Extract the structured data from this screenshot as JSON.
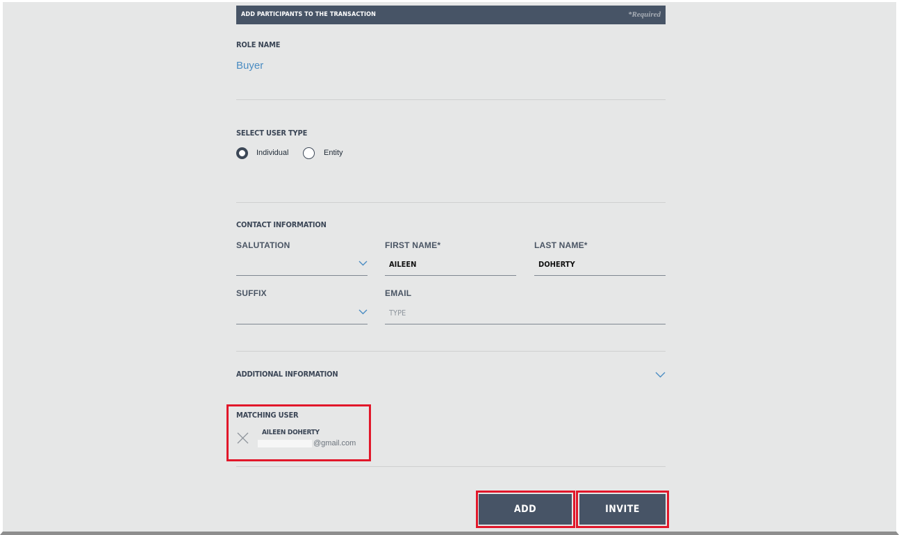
{
  "header": {
    "title": "ADD PARTICIPANTS TO THE TRANSACTION",
    "required_note": "*Required"
  },
  "role": {
    "label": "ROLE NAME",
    "value": "Buyer"
  },
  "user_type": {
    "label": "SELECT USER TYPE",
    "options": [
      {
        "label": "Individual",
        "selected": true
      },
      {
        "label": "Entity",
        "selected": false
      }
    ]
  },
  "contact": {
    "label": "CONTACT INFORMATION",
    "salutation": {
      "label": "SALUTATION",
      "value": ""
    },
    "first_name": {
      "label": "FIRST NAME*",
      "value": "AILEEN"
    },
    "last_name": {
      "label": "LAST NAME*",
      "value": "DOHERTY"
    },
    "suffix": {
      "label": "SUFFIX",
      "value": ""
    },
    "email": {
      "label": "EMAIL",
      "placeholder": "TYPE",
      "value": ""
    }
  },
  "additional": {
    "label": "ADDITIONAL INFORMATION"
  },
  "matching_user": {
    "label": "MATCHING USER",
    "name": "AILEEN DOHERTY",
    "email_suffix": "@gmail.com"
  },
  "actions": {
    "add_label": "ADD",
    "invite_label": "INVITE"
  },
  "colors": {
    "accent": "#4a8cc2",
    "primary_dark": "#475466",
    "highlight_red": "#e1172a",
    "background": "#e6e7e7"
  }
}
